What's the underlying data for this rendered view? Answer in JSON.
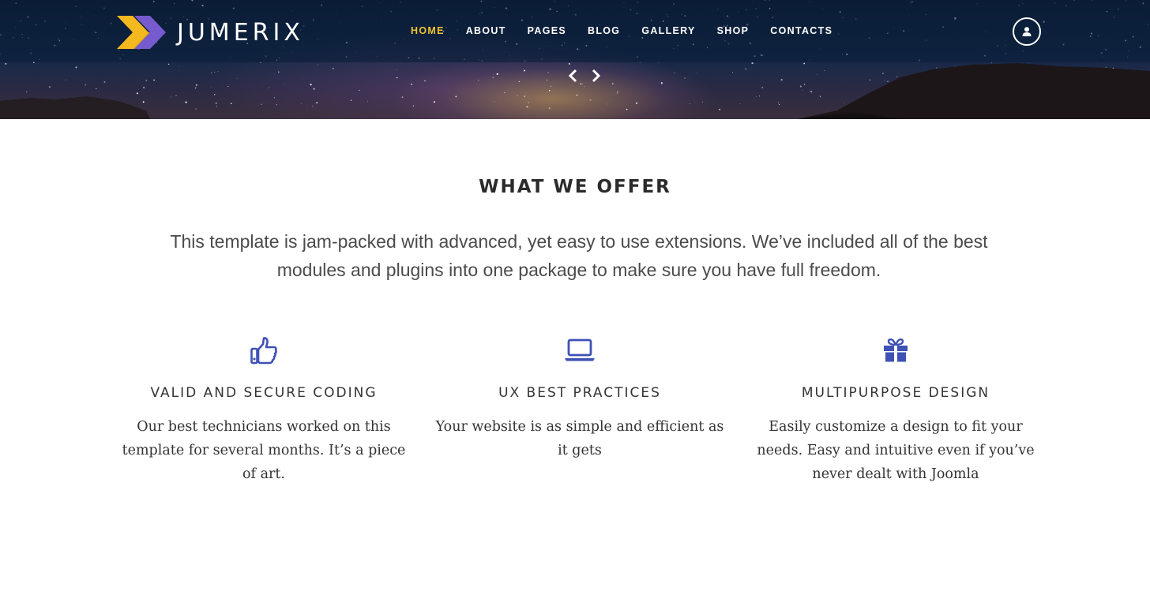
{
  "brand": {
    "name": "JUMERIX",
    "colors": {
      "mark_yellow": "#f5b920",
      "mark_purple": "#7b5fd6"
    }
  },
  "nav": {
    "items": [
      {
        "label": "HOME",
        "active": true
      },
      {
        "label": "ABOUT",
        "active": false
      },
      {
        "label": "PAGES",
        "active": false
      },
      {
        "label": "BLOG",
        "active": false
      },
      {
        "label": "GALLERY",
        "active": false
      },
      {
        "label": "SHOP",
        "active": false
      },
      {
        "label": "CONTACTS",
        "active": false
      }
    ],
    "active_color": "#f1c232",
    "user_icon": "user-icon"
  },
  "slider": {
    "prev_icon": "chevron-left-icon",
    "next_icon": "chevron-right-icon"
  },
  "offer": {
    "title": "WHAT WE OFFER",
    "intro": "This template is jam-packed with advanced, yet easy to use extensions. We’ve included all of the best modules and plugins into one package to make sure you have full freedom."
  },
  "features": [
    {
      "icon": "thumbs-up-icon",
      "title": "VALID AND SECURE CODING",
      "text": "Our best technicians worked on this template for several months. It’s a piece of art."
    },
    {
      "icon": "laptop-icon",
      "title": "UX BEST PRACTICES",
      "text": "Your website is as simple and efficient as it gets"
    },
    {
      "icon": "gift-icon",
      "title": "MULTIPURPOSE DESIGN",
      "text": "Easily customize a design to fit your needs. Easy and intuitive even if you’ve never dealt with Joomla"
    }
  ],
  "icon_color": "#3f51b5"
}
